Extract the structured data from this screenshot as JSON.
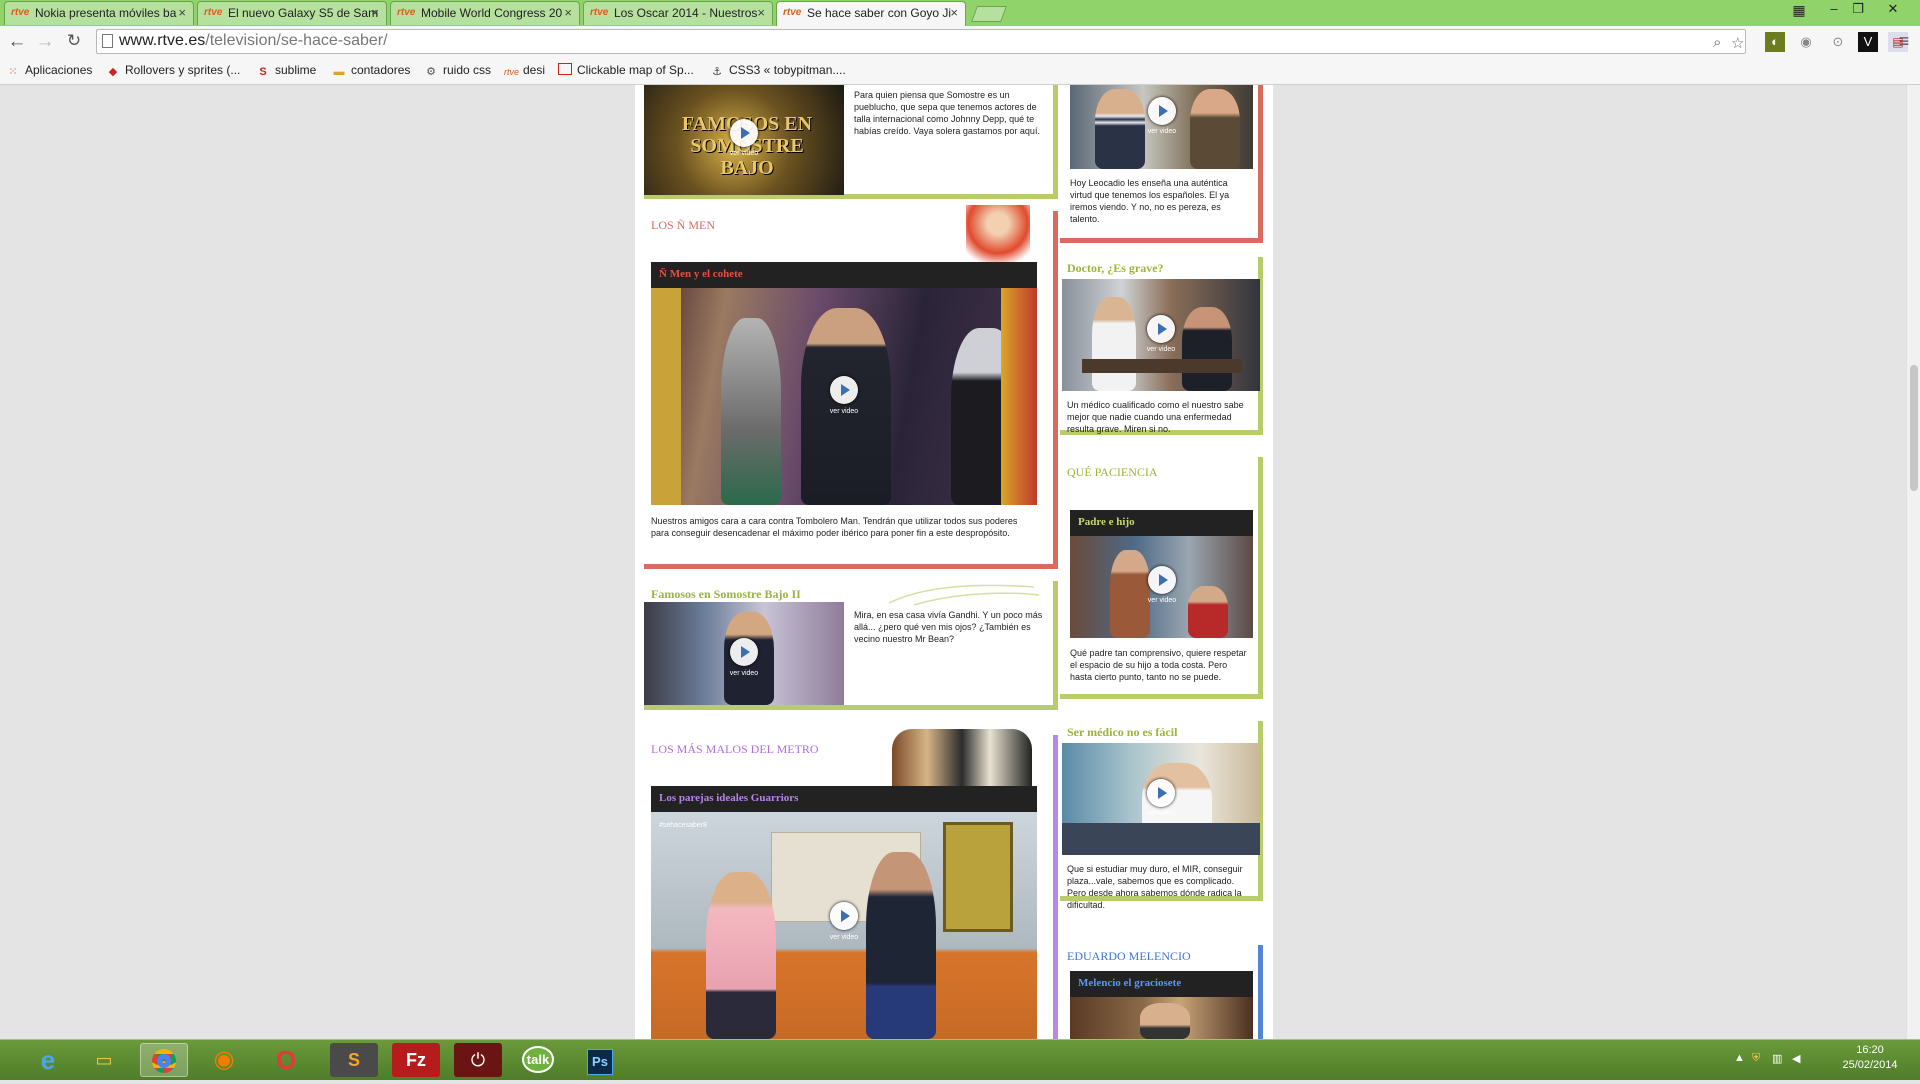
{
  "browser": {
    "tabs": [
      {
        "label": "Nokia presenta móviles ba",
        "active": false
      },
      {
        "label": "El nuevo Galaxy S5 de Sam",
        "active": false
      },
      {
        "label": "Mobile World Congress 20",
        "active": false
      },
      {
        "label": "Los Oscar 2014 - Nuestros",
        "active": false
      },
      {
        "label": "Se hace saber con Goyo Ji",
        "active": true
      }
    ],
    "favicon_text": "rtve",
    "url_host": "www.rtve.es",
    "url_path": "/television/se-hace-saber/",
    "bookmarks": [
      {
        "label": "Aplicaciones",
        "icon": "apps-grid-icon"
      },
      {
        "label": "Rollovers y sprites (...",
        "icon": "red-drop-icon"
      },
      {
        "label": "sublime",
        "icon": "sublime-icon"
      },
      {
        "label": "contadores",
        "icon": "folder-icon"
      },
      {
        "label": "ruido css",
        "icon": "gear-icon"
      },
      {
        "label": "desi",
        "icon": "rtve-icon"
      },
      {
        "label": "Clickable map of Sp...",
        "icon": "map-icon"
      },
      {
        "label": "CSS3 « tobypitman....",
        "icon": "css-icon"
      }
    ]
  },
  "page": {
    "ver_video": "ver video",
    "left": {
      "famosos_desc": "Para quien piensa que Somostre es un pueblucho, que sepa que tenemos actores de talla internacional como Johnny Depp, qué te habías creído. Vaya solera gastamos por aquí.",
      "famosos_thumb_text": "FAMOSOS EN SOMOSTRE BAJO",
      "n_men_section": "LOS Ñ MEN",
      "n_men_video_title": "Ñ Men y el cohete",
      "n_men_desc": "Nuestros amigos cara a cara contra Tombolero Man. Tendrán que utilizar todos sus poderes para conseguir desencadenar el máximo poder ibérico para poner fin a este despropósito.",
      "famosos2_title": "Famosos en Somostre Bajo II",
      "famosos2_desc": "Mira, en esa casa vivía Gandhi. Y un poco más allá... ¿pero qué ven mis ojos? ¿También es vecino nuestro Mr Bean?",
      "metro_section": "LOS MÁS MALOS DEL METRO",
      "metro_video_title": "Los parejas ideales Guarriors",
      "metro_watermark": "#sehacesaber8"
    },
    "right": {
      "leocadio_desc": "Hoy Leocadio les enseña una auténtica virtud que tenemos los españoles. El ya iremos viendo. Y no, no es pereza, es talento.",
      "doctor_title": "Doctor, ¿Es grave?",
      "doctor_desc": "Un médico cualificado como el nuestro sabe mejor que nadie cuando una enfermedad resulta grave. Miren si no.",
      "paciencia_section": "QUÉ PACIENCIA",
      "padre_title": "Padre e hijo",
      "padre_desc": "Qué padre tan comprensivo, quiere respetar el espacio de su hijo a toda costa. Pero hasta cierto punto, tanto no se puede.",
      "medico_title": "Ser médico no es fácil",
      "medico_desc": "Que si estudiar muy duro, el MIR, conseguir plaza...vale, sabemos que es complicado. Pero desde ahora sabemos dónde radica la dificultad.",
      "melencio_section": "EDUARDO MELENCIO",
      "melencio_title": "Melencio el graciosete"
    },
    "colors": {
      "red": "#d86a5e",
      "green": "#9bb53a",
      "purple": "#b06ee0",
      "blue": "#3f74d2"
    }
  },
  "taskbar": {
    "apps": [
      "ie-icon",
      "explorer-icon",
      "chrome-icon",
      "firefox-icon",
      "opera-icon",
      "sublime-icon",
      "filezilla-icon",
      "power-icon",
      "gtalk-icon",
      "photoshop-icon"
    ],
    "time": "16:20",
    "date": "25/02/2014"
  }
}
